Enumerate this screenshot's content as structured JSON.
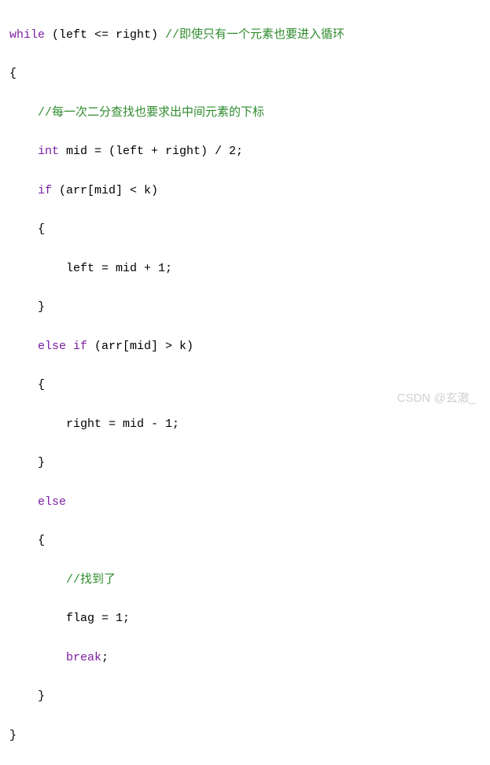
{
  "code": {
    "l1_kw": "while",
    "l1_cond": " (left <= right) ",
    "l1_comment": "//即使只有一个元素也要进入循环",
    "l2": "{",
    "l3_comment": "//每一次二分查找也要求出中间元素的下标",
    "l4_type": "int",
    "l4_rest": " mid = (left + right) / 2;",
    "l5_kw": "if",
    "l5_cond": " (arr[mid] < k)",
    "l6": "{",
    "l7": "left = mid + 1;",
    "l8": "}",
    "l9_kw": "else if",
    "l9_cond": " (arr[mid] > k)",
    "l10": "{",
    "l11": "right = mid - 1;",
    "l12": "}",
    "l13_kw": "else",
    "l14": "{",
    "l15_comment": "//找到了",
    "l16": "flag = 1;",
    "l17_kw": "break",
    "l17_rest": ";",
    "l18": "}",
    "l19": "}"
  },
  "watermark": "CSDN @玄澈_"
}
